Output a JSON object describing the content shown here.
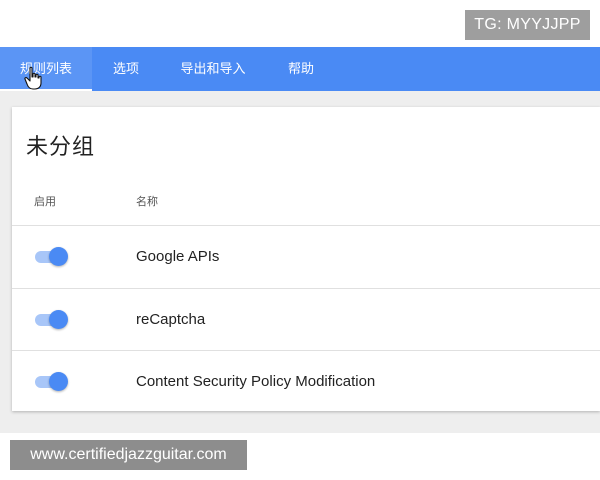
{
  "watermarks": {
    "top": "TG: MYYJJPP",
    "bottom": "www.certifiedjazzguitar.com"
  },
  "nav": {
    "tabs": [
      {
        "label": "规则列表",
        "active": true
      },
      {
        "label": "选项",
        "active": false
      },
      {
        "label": "导出和导入",
        "active": false
      },
      {
        "label": "帮助",
        "active": false
      }
    ]
  },
  "group": {
    "title": "未分组",
    "columns": {
      "enabled": "启用",
      "name": "名称"
    },
    "rules": [
      {
        "name": "Google APIs",
        "enabled": true
      },
      {
        "name": "reCaptcha",
        "enabled": true
      },
      {
        "name": "Content Security Policy Modification",
        "enabled": true
      }
    ]
  },
  "colors": {
    "accent": "#4a8af4",
    "toggle_track": "#a8c6f8",
    "background": "#eeeeee"
  },
  "icons": {
    "cursor": "hand-pointer-icon"
  }
}
